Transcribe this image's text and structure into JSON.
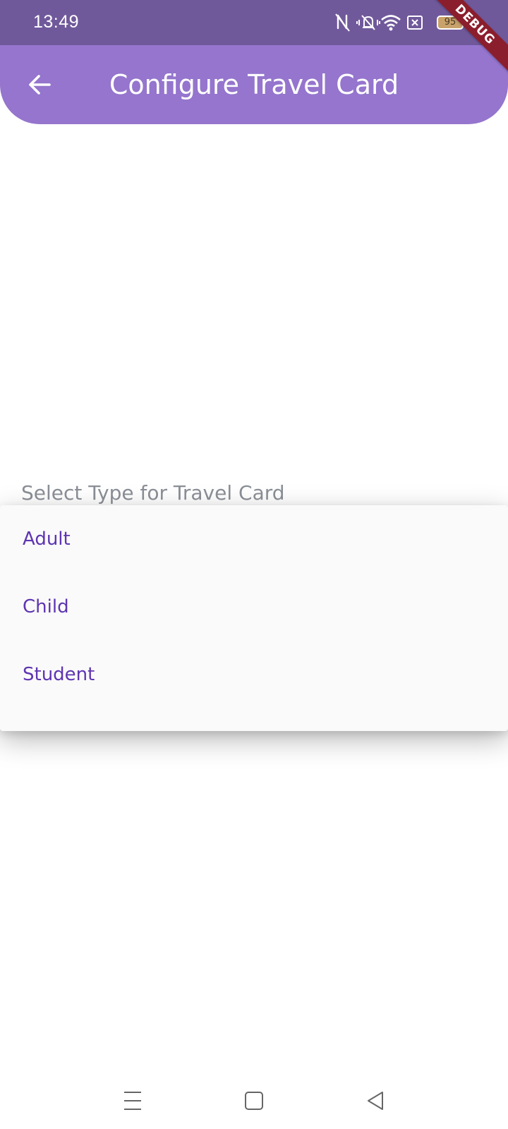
{
  "status_bar": {
    "time": "13:49",
    "battery_level": "95",
    "icons": [
      "nfc-icon",
      "vibrate-icon",
      "wifi-icon",
      "sim-x-icon",
      "battery-icon",
      "charging-icon"
    ]
  },
  "debug_banner": "DEBUG",
  "app_bar": {
    "title": "Configure Travel Card",
    "back_icon": "arrow-left-icon",
    "background": "#9575cd"
  },
  "form": {
    "field_label": "Select Type for Travel Card"
  },
  "dropdown": {
    "options": [
      "Adult",
      "Child",
      "Student"
    ],
    "option_color": "#5e35b1"
  },
  "nav_bar": {
    "icons": [
      "menu-icon",
      "home-icon",
      "back-triangle-icon"
    ]
  },
  "colors": {
    "status_bar": "#70599b",
    "app_bar": "#9575cd",
    "debug_ribbon": "#8b1e2d",
    "label_gray": "#8b8f97"
  }
}
